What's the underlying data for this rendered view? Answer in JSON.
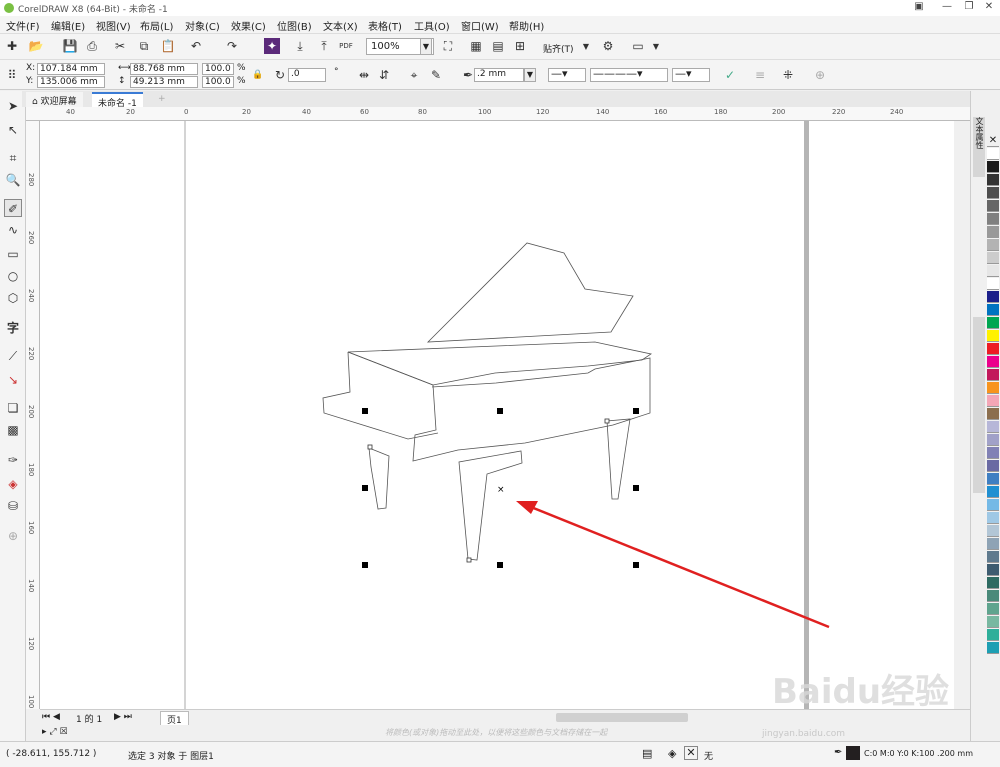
{
  "window": {
    "title": "CorelDRAW X8 (64-Bit) - 未命名 -1"
  },
  "menu": [
    "文件(F)",
    "编辑(E)",
    "视图(V)",
    "布局(L)",
    "对象(C)",
    "效果(C)",
    "位图(B)",
    "文本(X)",
    "表格(T)",
    "工具(O)",
    "窗口(W)",
    "帮助(H)"
  ],
  "toolbar": {
    "zoom": "100%",
    "snap_label": "贴齐(T)",
    "pdf_label": "PDF"
  },
  "props": {
    "x": "107.184 mm",
    "y": "135.006 mm",
    "w": "88.768 mm",
    "h": "49.213 mm",
    "sx": "100.0",
    "sy": "100.0",
    "pct": "%",
    "angle": ".0",
    "outline": ".2 mm"
  },
  "tabs": {
    "welcome": "欢迎屏幕",
    "doc": "未命名 -1"
  },
  "ruler_h": [
    "40",
    "20",
    "0",
    "20",
    "40",
    "60",
    "80",
    "100",
    "120",
    "140",
    "160",
    "180",
    "200",
    "220",
    "240"
  ],
  "ruler_v": [
    "280",
    "260",
    "240",
    "220",
    "200",
    "180",
    "160",
    "140",
    "120",
    "100",
    "80"
  ],
  "pagebar": {
    "page_of": "1 的 1",
    "page_tab": "页1"
  },
  "hint": "将颜色(或对象)拖动至此处，以便将这些颜色与文档存储在一起",
  "status": {
    "coords": "( -28.611, 155.712 )",
    "selection": "选定 3 对象 于 图层1",
    "fill_none": "无",
    "color_info": "C:0 M:0 Y:0 K:100 .200 mm"
  },
  "docker": {
    "tab_label": "文本属性"
  },
  "watermark": {
    "brand": "Baidu经验",
    "url": "jingyan.baidu.com"
  },
  "palette": [
    "#ffffff",
    "#1a1a1a",
    "#333333",
    "#4d4d4d",
    "#666666",
    "#808080",
    "#999999",
    "#b3b3b3",
    "#cccccc",
    "#e6e6e6",
    "#ffffff",
    "#1b1f8a",
    "#0073c0",
    "#00a651",
    "#fff200",
    "#ed1c24",
    "#ec008c",
    "#c2185b",
    "#f7941d",
    "#f4a6b6",
    "#8b6e4e",
    "#b7b7d8",
    "#a1a1c8",
    "#8181b5",
    "#6a6aa3",
    "#3f7fc2",
    "#1f8fd1",
    "#74b9e6",
    "#9fc8e5",
    "#b2c6d6",
    "#8ea3b5",
    "#5f7a8e",
    "#3e5c70",
    "#2e6b62",
    "#4a8a7a",
    "#5fa48e",
    "#78b8a1",
    "#2eaf9a",
    "#1e9fb3"
  ]
}
